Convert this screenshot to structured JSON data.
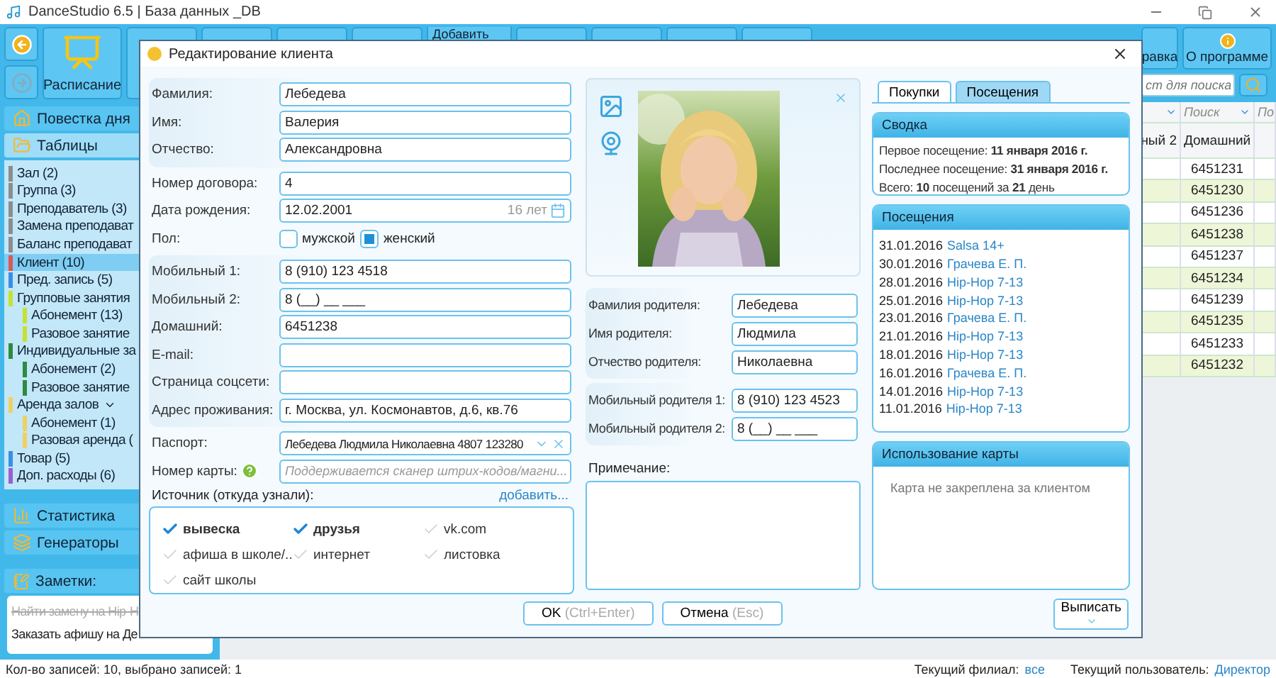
{
  "app": {
    "title": "DanceStudio 6.5 | База данных _DB"
  },
  "toolbar": {
    "schedule": "Расписание",
    "add": "Добавить",
    "help": "равка",
    "about": "О программе",
    "search_placeholder": "ст для поиска"
  },
  "sidebar": {
    "sections": [
      {
        "label": "Повестка дня",
        "selected": false
      },
      {
        "label": "Таблицы",
        "selected": true
      }
    ],
    "tree": [
      {
        "label": "Зал (2)",
        "color": "#8c8c8c",
        "selected": false
      },
      {
        "label": "Группа (3)",
        "color": "#8c8c8c",
        "selected": false
      },
      {
        "label": "Преподаватель (3)",
        "color": "#8c8c8c",
        "selected": false
      },
      {
        "label": "Замена преподават",
        "color": "#8c8c8c",
        "selected": false
      },
      {
        "label": "Баланс преподават",
        "color": "#8c8c8c",
        "selected": false
      },
      {
        "label": "Клиент (10)",
        "color": "#e05555",
        "selected": true
      },
      {
        "label": "Пред. запись (5)",
        "color": "#3a8ee6",
        "selected": false
      },
      {
        "label": "Групповые занятия",
        "color": "#c6e22e",
        "selected": false,
        "children": [
          {
            "label": "Абонемент (13)",
            "color": "#c6e22e",
            "selected": false
          },
          {
            "label": "Разовое занятие",
            "color": "#c6e22e",
            "selected": false
          }
        ]
      },
      {
        "label": "Индивидуальные за",
        "color": "#2e8b3e",
        "selected": false,
        "children": [
          {
            "label": "Абонемент (2)",
            "color": "#2e8b3e",
            "selected": false
          },
          {
            "label": "Разовое занятие",
            "color": "#2e8b3e",
            "selected": false
          }
        ]
      },
      {
        "label": "Аренда залов",
        "color": "#f0d060",
        "selected": false,
        "dropdown": true,
        "children": [
          {
            "label": "Абонемент (1)",
            "color": "#f0d060",
            "selected": false
          },
          {
            "label": "Разовая аренда (",
            "color": "#f0d060",
            "selected": false
          }
        ]
      },
      {
        "label": "Товар (5)",
        "color": "#3a8ee6",
        "selected": false
      },
      {
        "label": "Доп. расходы (6)",
        "color": "#9a5fd0",
        "selected": false
      }
    ],
    "lower_sections": [
      "Статистика",
      "Генераторы"
    ],
    "notes": {
      "title": "Заметки:",
      "items": [
        {
          "text": "Найти замену на Hip-H",
          "done": true
        },
        {
          "text": "Заказать афишу на Де",
          "done": false
        }
      ]
    }
  },
  "table": {
    "filters": [
      "Поиск",
      "По"
    ],
    "columns": [
      "ный 2",
      "Домашний"
    ],
    "rows": [
      "6451231",
      "6451230",
      "6451236",
      "6451238",
      "6451237",
      "6451234",
      "6451239",
      "6451235",
      "6451233",
      "6451232"
    ]
  },
  "status_bar": {
    "records": "Кол-во записей: 10, выбрано записей: 1",
    "branch_label": "Текущий филиал:",
    "branch": "все",
    "user_label": "Текущий пользователь:",
    "user": "Директор"
  },
  "dialog": {
    "title": "Редактирование клиента",
    "groups": [
      {
        "panel": true,
        "fields": [
          {
            "label": "Фамилия:",
            "kind": "text",
            "value": "Лебедева"
          },
          {
            "label": "Имя:",
            "kind": "text",
            "value": "Валерия"
          },
          {
            "label": "Отчество:",
            "kind": "text",
            "value": "Александровна"
          }
        ]
      },
      {
        "panel": false,
        "fields": [
          {
            "label": "Номер договора:",
            "kind": "text",
            "value": "4"
          },
          {
            "label": "Дата рождения:",
            "kind": "date",
            "value": "12.02.2001",
            "age": "16 лет"
          },
          {
            "label": "Пол:",
            "kind": "choice",
            "options": [
              {
                "label": "мужской",
                "selected": false
              },
              {
                "label": "женский",
                "selected": true
              }
            ]
          }
        ]
      },
      {
        "panel": true,
        "fields": [
          {
            "label": "Мобильный 1:",
            "kind": "text",
            "value": "8 (910) 123 4518"
          },
          {
            "label": "Мобильный 2:",
            "kind": "text",
            "value": "8 (__) __ ___"
          },
          {
            "label": "Домашний:",
            "kind": "text",
            "value": "6451238"
          },
          {
            "label": "E-mail:",
            "kind": "text"
          },
          {
            "label": "Страница соцсети:",
            "kind": "text"
          },
          {
            "label": "Адрес проживания:",
            "kind": "text",
            "value": "г. Москва, ул. Космонавтов, д.6, кв.76"
          }
        ]
      },
      {
        "panel": false,
        "fields": [
          {
            "label": "Паспорт:",
            "kind": "combo",
            "value": "Лебедева Людмила Николаевна 4807 123280"
          },
          {
            "label": "Номер карты:",
            "kind": "card",
            "placeholder": "Поддерживается сканер штрих-кодов/магни..."
          }
        ]
      }
    ],
    "source": {
      "label": "Источник (откуда узнали):",
      "add_link": "добавить...",
      "options": [
        {
          "label": "вывеска",
          "checked": true
        },
        {
          "label": "друзья",
          "checked": true
        },
        {
          "label": "vk.com",
          "checked": false
        },
        {
          "label": "афиша в школе/..",
          "checked": false
        },
        {
          "label": "интернет",
          "checked": false
        },
        {
          "label": "листовка",
          "checked": false
        },
        {
          "label": "сайт школы",
          "checked": false
        }
      ]
    },
    "parent_groups": [
      {
        "fields": [
          {
            "label": "Фамилия родителя:",
            "value": "Лебедева"
          },
          {
            "label": "Имя родителя:",
            "value": "Людмила"
          },
          {
            "label": "Отчество родителя:",
            "value": "Николаевна"
          }
        ]
      },
      {
        "fields": [
          {
            "label": "Мобильный родителя 1:",
            "value": "8 (910) 123 4523"
          },
          {
            "label": "Мобильный родителя 2:",
            "value": "8 (__) __ ___"
          }
        ]
      }
    ],
    "note_label": "Примечание:",
    "tabs": [
      {
        "label": "Покупки",
        "selected": false
      },
      {
        "label": "Посещения",
        "selected": true
      }
    ],
    "summary": {
      "title": "Сводка",
      "lines": [
        "Первое посещение: **11 января 2016 г.**",
        "Последнее посещение: **31 января 2016 г.**",
        "Всего: **10** посещений за **21** день"
      ]
    },
    "visits": {
      "title": "Посещения",
      "items": [
        {
          "date": "31.01.2016",
          "activity": "Salsa 14+"
        },
        {
          "date": "30.01.2016",
          "activity": "Грачева Е. П."
        },
        {
          "date": "28.01.2016",
          "activity": "Hip-Hop 7-13"
        },
        {
          "date": "25.01.2016",
          "activity": "Hip-Hop 7-13"
        },
        {
          "date": "23.01.2016",
          "activity": "Грачева Е. П."
        },
        {
          "date": "21.01.2016",
          "activity": "Hip-Hop 7-13"
        },
        {
          "date": "18.01.2016",
          "activity": "Hip-Hop 7-13"
        },
        {
          "date": "16.01.2016",
          "activity": "Грачева Е. П."
        },
        {
          "date": "14.01.2016",
          "activity": "Hip-Hop 7-13"
        },
        {
          "date": "11.01.2016",
          "activity": "Hip-Hop 7-13"
        }
      ]
    },
    "card_usage": {
      "title": "Использование карты",
      "message": "Карта не закреплена за клиентом"
    },
    "write_button": "Выписать",
    "buttons": [
      {
        "label": "OK",
        "shortcut": "(Ctrl+Enter)"
      },
      {
        "label": "Отмена",
        "shortcut": "(Esc)"
      }
    ]
  }
}
